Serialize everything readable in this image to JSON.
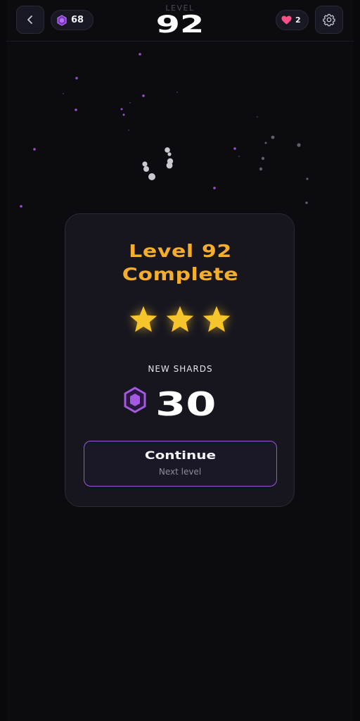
{
  "header": {
    "level_label": "LEVEL",
    "level_number": "92",
    "shards": "68",
    "lives": "2",
    "icons": {
      "back": "chevron-left-icon",
      "shard": "hexagon-gem-icon",
      "lives": "heart-icon",
      "settings": "gear-icon"
    }
  },
  "card": {
    "title_line1": "Level 92",
    "title_line2": "Complete",
    "stars_earned": 3,
    "stars_total": 3,
    "new_shards_label": "NEW SHARDS",
    "new_shards_value": "30",
    "continue_label": "Continue",
    "continue_sublabel": "Next level"
  },
  "colors": {
    "background": "#0b0b10",
    "card": "#17161f",
    "title": "#f5ad2c",
    "star": "#f6c52c",
    "gem": "#a35ae0",
    "heart": "#ff4f86",
    "button_border": "#9d55d8"
  }
}
